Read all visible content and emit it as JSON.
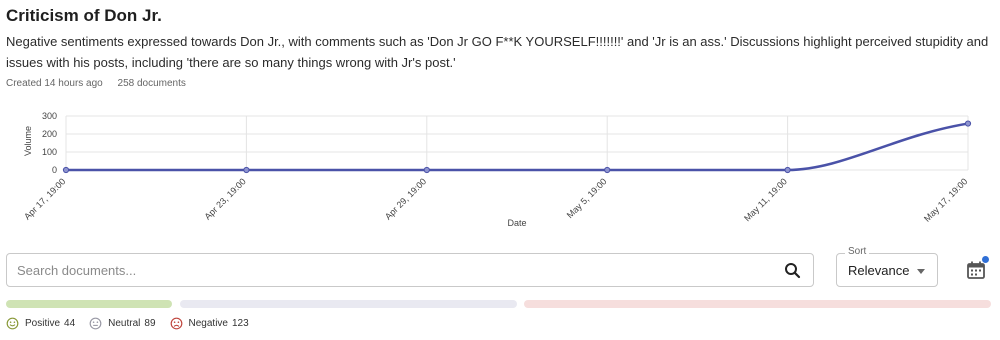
{
  "header": {
    "title": "Criticism of Don Jr.",
    "description": "Negative sentiments expressed towards Don Jr., with comments such as 'Don Jr GO F**K YOURSELF!!!!!!!' and 'Jr is an ass.' Discussions highlight perceived stupidity and issues with his posts, including 'there are so many things wrong with Jr's post.'",
    "created": "Created 14 hours ago",
    "documents": "258 documents"
  },
  "chart_data": {
    "type": "line",
    "x": [
      "Apr 17, 19:00",
      "Apr 23, 19:00",
      "Apr 29, 19:00",
      "May 5, 19:00",
      "May 11, 19:00",
      "May 17, 19:00"
    ],
    "values": [
      0,
      0,
      0,
      0,
      0,
      258
    ],
    "xlabel": "Date",
    "ylabel": "Volume",
    "yticks": [
      0,
      100,
      200,
      300
    ],
    "ylim": [
      0,
      300
    ],
    "grid": true,
    "line_color": "#4a52a8"
  },
  "search": {
    "placeholder": "Search documents..."
  },
  "sort": {
    "label": "Sort",
    "value": "Relevance"
  },
  "sentiment": {
    "positive": {
      "label": "Positive",
      "count": "44",
      "color": "#cfe3b4"
    },
    "neutral": {
      "label": "Neutral",
      "count": "89",
      "color": "#e9e9f1"
    },
    "negative": {
      "label": "Negative",
      "count": "123",
      "color": "#f6dedd"
    }
  },
  "icons": {
    "search": "search-icon",
    "calendar": "calendar-icon",
    "sort_caret": "chevron-down-icon"
  },
  "colors": {
    "accent_dot": "#2f6fd6"
  }
}
